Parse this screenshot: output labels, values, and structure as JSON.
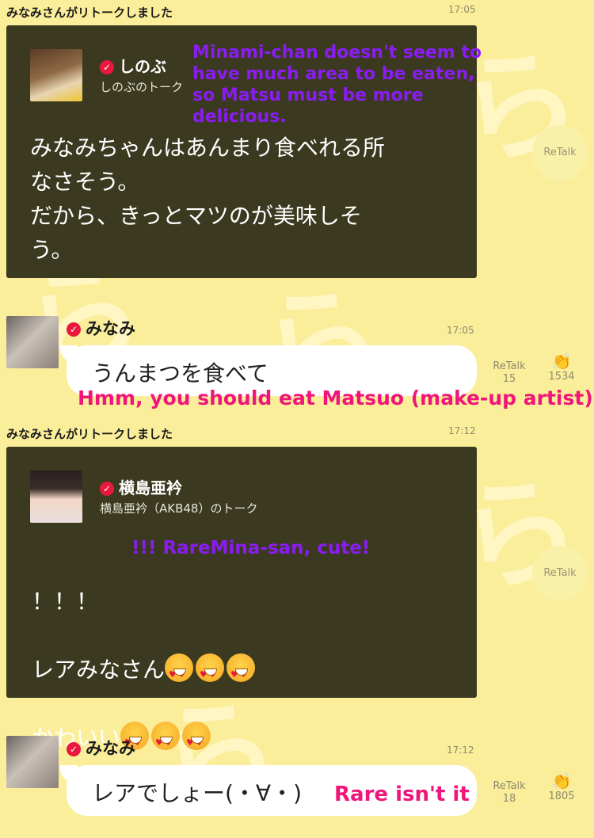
{
  "colors": {
    "background": "#fbee9a",
    "card": "#3b3a20",
    "accent_check": "#e8183e",
    "overlay_purple": "#8a1cf2",
    "overlay_pink": "#f0157a"
  },
  "posts": [
    {
      "retalk_header": "みなみさんがリトークしました",
      "time": "17:05",
      "card": {
        "name": "しのぶ",
        "subtitle": "しのぶのトーク",
        "body": "みなみちゃんはあんまり食べれる所\nなさそう。\nだから、きっとマツのが美味しそ\nう。"
      },
      "retalk_button": "ReTalk",
      "translation": "Minami-chan doesn't seem to have much area to be eaten, so Matsu must be more delicious."
    },
    {
      "user": "みなみ",
      "time": "17:05",
      "message": "うんまつを食べて",
      "retalk_label": "ReTalk",
      "retalk_count": "15",
      "clap_count": "1534",
      "translation": "Hmm, you should eat Matsuo (make-up artist)"
    },
    {
      "retalk_header": "みなみさんがリトークしました",
      "time": "17:12",
      "card": {
        "name": "横島亜衿",
        "subtitle": "横島亜衿（AKB48）のトーク",
        "line1": "！！！",
        "line2": "レアみなさん",
        "line3": "かわいい"
      },
      "retalk_button": "ReTalk",
      "translation": "!!! RareMina-san, cute!"
    },
    {
      "user": "みなみ",
      "time": "17:12",
      "message": "レアでしょー(・∀・)",
      "retalk_label": "ReTalk",
      "retalk_count": "18",
      "clap_count": "1805",
      "translation": "Rare isn't it"
    }
  ]
}
